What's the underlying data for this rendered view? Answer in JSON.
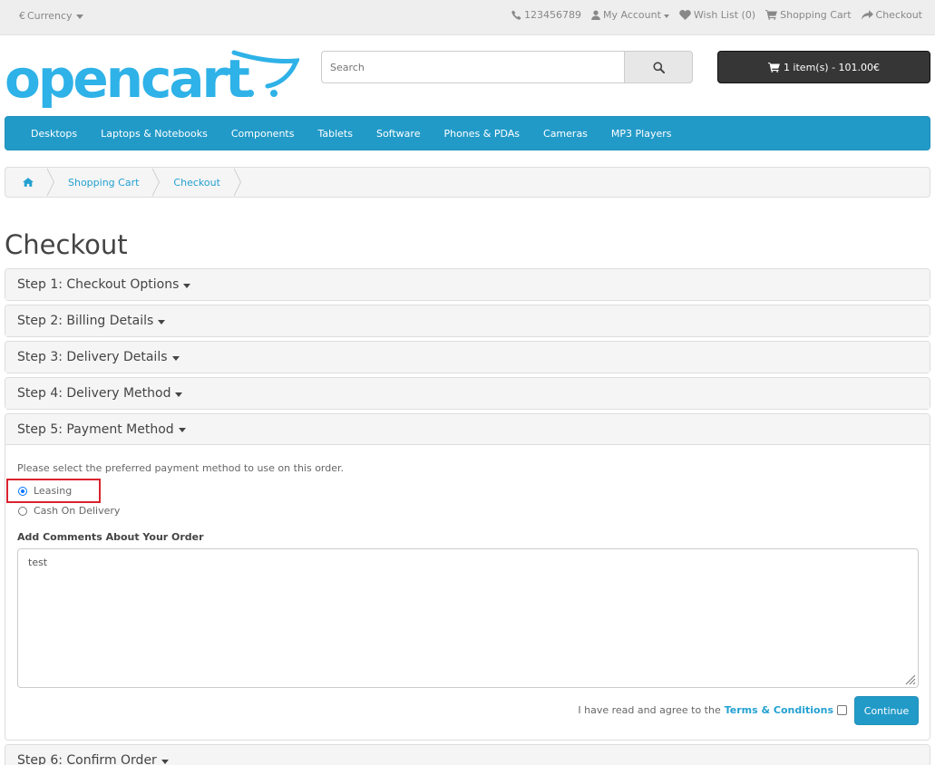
{
  "topbar": {
    "currency_symbol": "€",
    "currency_label": "Currency",
    "phone": "123456789",
    "my_account": "My Account",
    "wish_list": "Wish List (0)",
    "shopping_cart": "Shopping Cart",
    "checkout": "Checkout"
  },
  "header": {
    "logo_text": "opencart",
    "search_placeholder": "Search",
    "cart_button": "1 item(s) - 101.00€"
  },
  "menu": [
    "Desktops",
    "Laptops & Notebooks",
    "Components",
    "Tablets",
    "Software",
    "Phones & PDAs",
    "Cameras",
    "MP3 Players"
  ],
  "breadcrumb": [
    "Shopping Cart",
    "Checkout"
  ],
  "page_title": "Checkout",
  "steps": [
    "Step 1: Checkout Options",
    "Step 2: Billing Details",
    "Step 3: Delivery Details",
    "Step 4: Delivery Method",
    "Step 5: Payment Method",
    "Step 6: Confirm Order"
  ],
  "payment": {
    "instruction": "Please select the preferred payment method to use on this order.",
    "methods": [
      {
        "label": "Leasing",
        "selected": true
      },
      {
        "label": "Cash On Delivery",
        "selected": false
      }
    ],
    "comments_label": "Add Comments About Your Order",
    "comments_value": "test",
    "agree_text": "I have read and agree to the",
    "terms_link": "Terms & Conditions",
    "agree_checked": false,
    "continue_label": "Continue"
  },
  "colors": {
    "brand_blue": "#229ac8",
    "link_blue": "#23a1d1",
    "highlight_red": "#d9232e",
    "cart_dark": "#363636"
  }
}
